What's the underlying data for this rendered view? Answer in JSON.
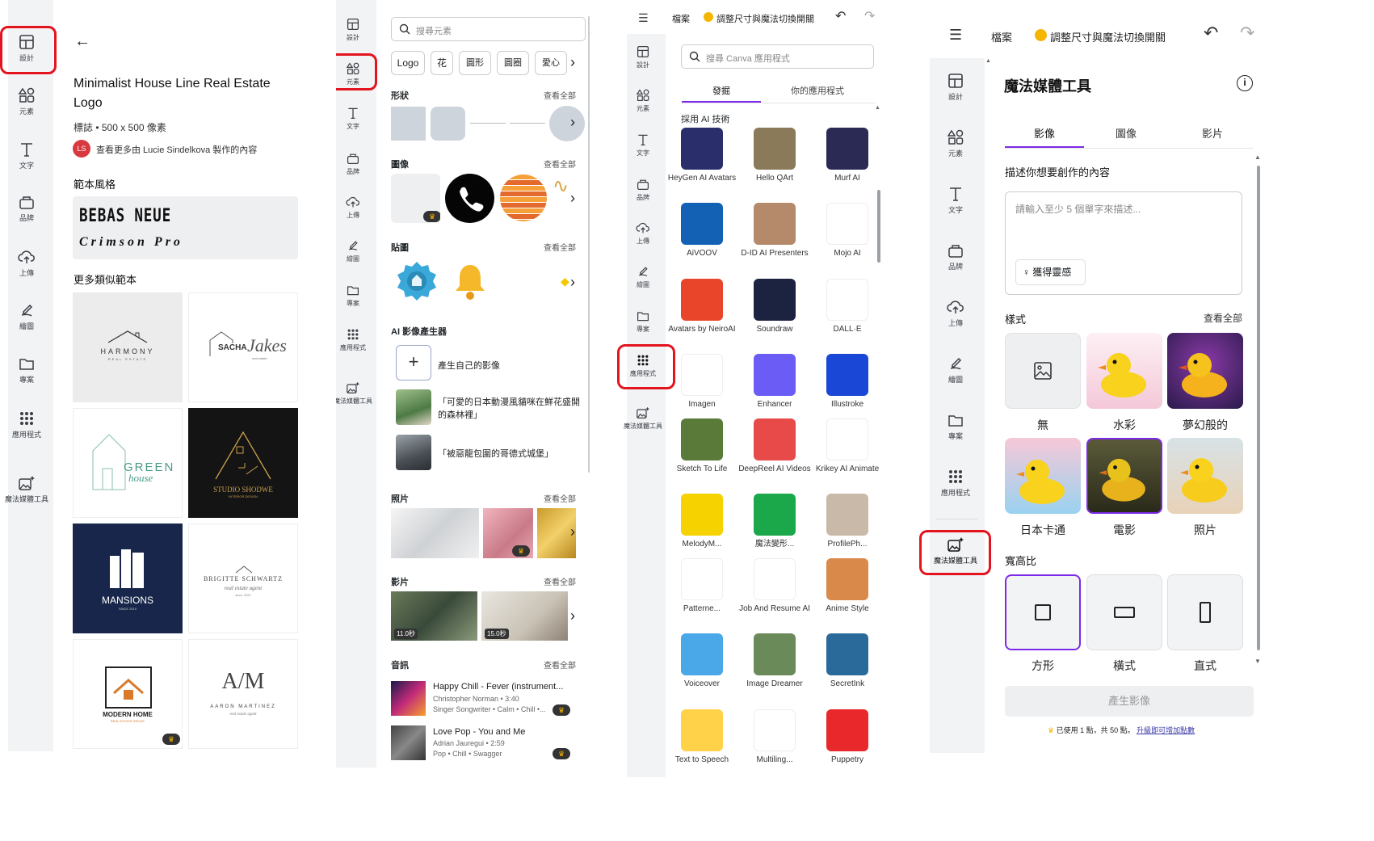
{
  "rail": {
    "design": "設計",
    "elements": "元素",
    "text": "文字",
    "brand": "品牌",
    "upload": "上傳",
    "draw": "繪圖",
    "projects": "專案",
    "apps": "應用程式",
    "magic_media": "魔法媒體工具"
  },
  "panel1": {
    "title": "Minimalist House Line Real Estate Logo",
    "meta": "標誌 • 500 x 500 像素",
    "author_initials": "LS",
    "author_link": "查看更多由 Lucie Sindelkova 製作的內容",
    "template_style_heading": "範本風格",
    "font1": "BEBAS NEUE",
    "font2": "Crimson Pro",
    "more_heading": "更多類似範本",
    "templates": [
      {
        "line1": "HARMONY",
        "line2": "REAL ESTATE"
      },
      {
        "line1": "SACHA",
        "line2": "Jakes",
        "line3": "real estate"
      },
      {
        "line1": "GREEN",
        "line2": "house"
      },
      {
        "line1": "STUDIO SHODWE",
        "line2": "INTERIOR DESIGN"
      },
      {
        "line1": "MANSIONS",
        "line2": "SINCE 2019"
      },
      {
        "line1": "BRIGITTE SCHWARTZ",
        "line2": "real estate agent",
        "line3": "since 2022"
      },
      {
        "line1": "MODERN HOME",
        "line2": "REAL ESTATE GROUP"
      },
      {
        "line1": "A/M",
        "line2": "AARON MARTINEZ",
        "line3": "real estate agent"
      }
    ]
  },
  "panel2": {
    "search_placeholder": "搜尋元素",
    "chips": [
      "Logo",
      "花",
      "圓形",
      "圓圈",
      "愛心"
    ],
    "see_all": "查看全部",
    "shapes": "形狀",
    "graphics": "圖像",
    "stickers": "貼圖",
    "ai_heading": "AI 影像產生器",
    "ai_items": [
      "產生自己的影像",
      "「可愛的日本動漫風貓咪在鮮花盛開的森林裡」",
      "「被惡龍包圍的哥德式城堡」"
    ],
    "photos": "照片",
    "videos": "影片",
    "video_durations": [
      "11.0秒",
      "15.0秒"
    ],
    "audio": "音訊",
    "tracks": [
      {
        "title": "Happy Chill - Fever (instrument...",
        "artist": "Christopher Norman • 3:40",
        "tags": "Singer Songwriter • Calm • Chill •..."
      },
      {
        "title": "Love Pop - You and Me",
        "artist": "Adrian Jauregui • 2:59",
        "tags": "Pop • Chill • Swagger"
      }
    ]
  },
  "topbar": {
    "file": "檔案",
    "resize": "調整尺寸與魔法切換開關"
  },
  "panel3": {
    "search_placeholder": "搜尋 Canva 應用程式",
    "tab_discover": "發掘",
    "tab_yours": "你的應用程式",
    "ai_heading": "採用 AI 技術",
    "apps": [
      {
        "name": "HeyGen AI Avatars",
        "color": "#2a2f6b"
      },
      {
        "name": "Hello QArt",
        "color": "#8a7a5a"
      },
      {
        "name": "Murf AI",
        "color": "#2b2a55"
      },
      {
        "name": "AiVOOV",
        "color": "#1261b5"
      },
      {
        "name": "D-ID AI Presenters",
        "color": "#b48a6a"
      },
      {
        "name": "Mojo AI",
        "color": "#ffffff"
      },
      {
        "name": "Avatars by NeiroAI",
        "color": "#e9452a"
      },
      {
        "name": "Soundraw",
        "color": "#1c2340"
      },
      {
        "name": "DALL·E",
        "color": "#ffffff"
      },
      {
        "name": "Imagen",
        "color": "#ffffff"
      },
      {
        "name": "Enhancer",
        "color": "#6a5cf5"
      },
      {
        "name": "Illustroke",
        "color": "#1a47d6"
      },
      {
        "name": "Sketch To Life",
        "color": "#5a7a3a"
      },
      {
        "name": "DeepReel AI Videos",
        "color": "#e84a4a"
      },
      {
        "name": "Krikey AI Animate",
        "color": "#ffffff"
      },
      {
        "name": "MelodyM...",
        "color": "#f5d200"
      },
      {
        "name": "魔法變形...",
        "color": "#1aa84a"
      },
      {
        "name": "ProfilePh...",
        "color": "#c9b9a9"
      },
      {
        "name": "Patterne...",
        "color": "#ffffff"
      },
      {
        "name": "Job And Resume AI",
        "color": "#ffffff"
      },
      {
        "name": "Anime Style",
        "color": "#d98a4a"
      },
      {
        "name": "Voiceover",
        "color": "#4aa8e8"
      },
      {
        "name": "Image Dreamer",
        "color": "#6a8a5a"
      },
      {
        "name": "SecretInk",
        "color": "#2a6a9a"
      },
      {
        "name": "Text to Speech",
        "color": "#ffd24a"
      },
      {
        "name": "Multiling...",
        "color": "#ffffff"
      },
      {
        "name": "Puppetry",
        "color": "#e8282a"
      }
    ]
  },
  "panel4": {
    "title": "魔法媒體工具",
    "tabs": [
      "影像",
      "圖像",
      "影片"
    ],
    "describe_label": "描述你想要創作的內容",
    "textarea_placeholder": "請輸入至少 5 個單字來描述...",
    "inspire_button": "獲得靈感",
    "style_heading": "樣式",
    "see_all": "查看全部",
    "styles": [
      "無",
      "水彩",
      "夢幻般的",
      "日本卡通",
      "電影",
      "照片"
    ],
    "aspect_heading": "寬高比",
    "aspects": [
      "方形",
      "橫式",
      "直式"
    ],
    "generate_button": "產生影像",
    "usage_prefix": "已使用 1 點，共 50 點。",
    "usage_link": "升級即可增加點數"
  }
}
